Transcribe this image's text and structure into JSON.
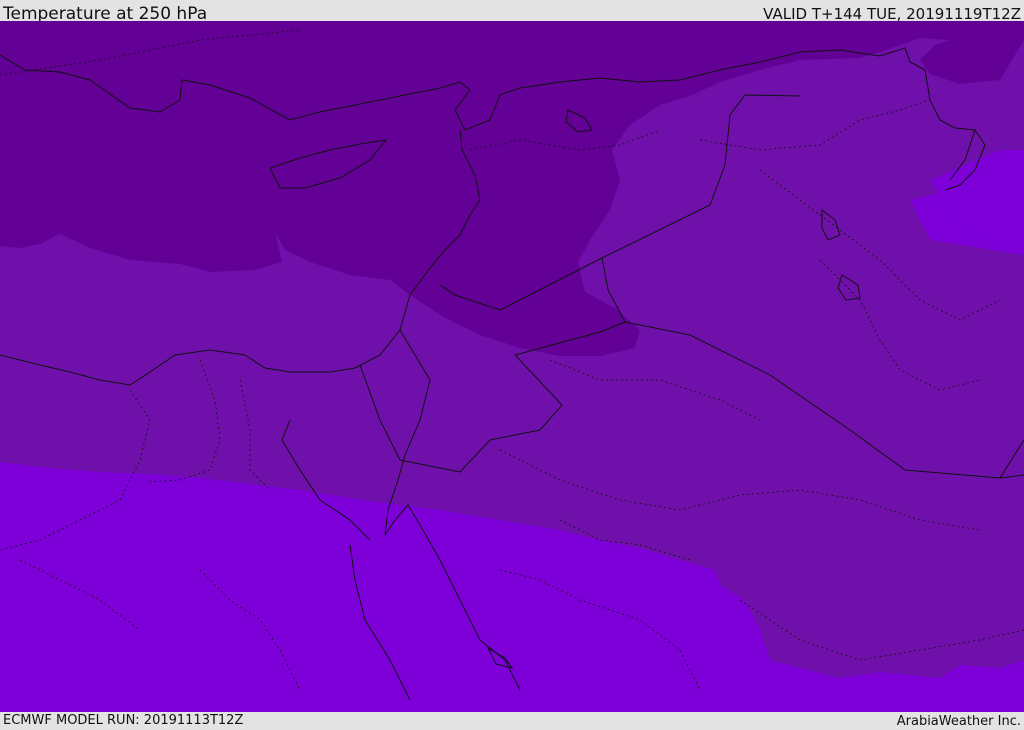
{
  "header": {
    "title": "Temperature at 250 hPa",
    "valid_time": "VALID T+144 TUE, 20191119T12Z"
  },
  "footer": {
    "model_run": "ECMWF MODEL RUN: 20191113T12Z",
    "credit": "ArabiaWeather Inc."
  },
  "colors": {
    "band_coldest": "#630096",
    "band_mid": "#7010ab",
    "band_warm": "#7d00d9",
    "coastline": "#111111",
    "bars": "#e3e3e3"
  }
}
